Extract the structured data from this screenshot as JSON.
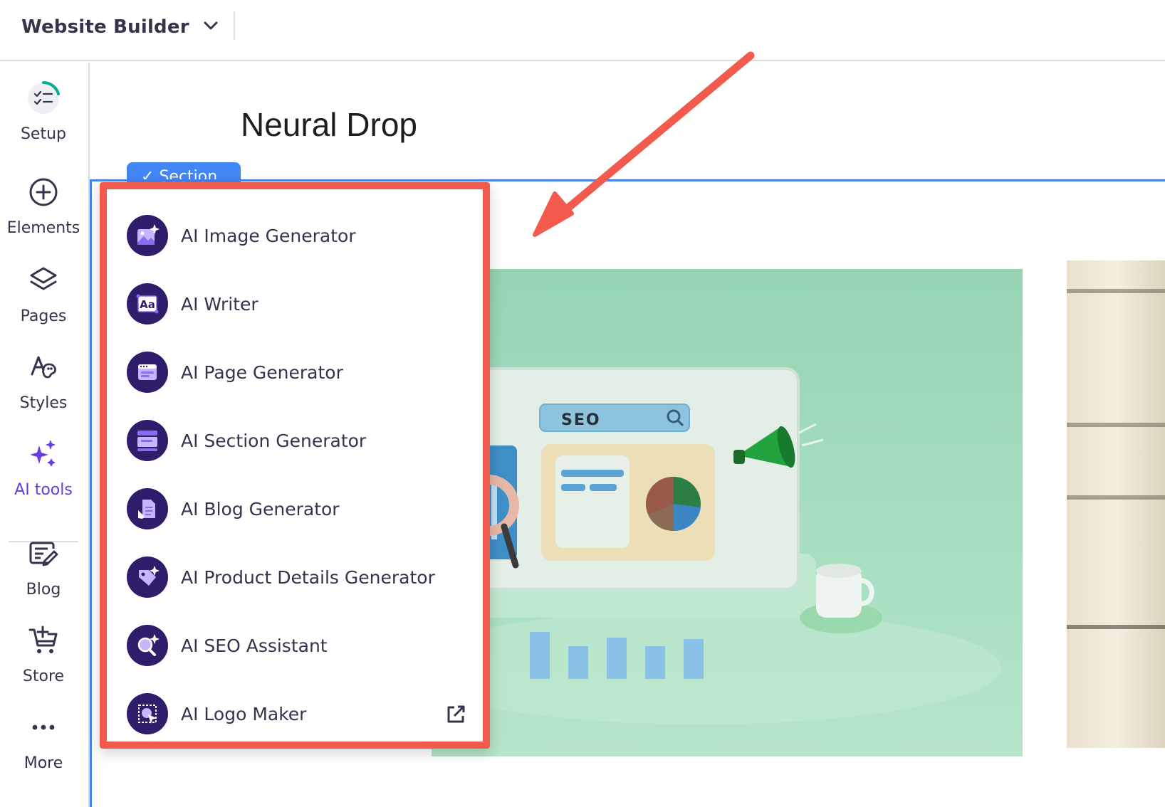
{
  "topbar": {
    "app_title": "Website Builder",
    "app_switch_icon": "chevron-down-icon"
  },
  "sidebar": {
    "items": [
      {
        "label": "Setup",
        "icon": "setup-progress-icon"
      },
      {
        "label": "Elements",
        "icon": "plus-circle-icon"
      },
      {
        "label": "Pages",
        "icon": "layers-icon"
      },
      {
        "label": "Styles",
        "icon": "palette-icon"
      },
      {
        "label": "AI tools",
        "icon": "sparkles-icon",
        "active": true
      },
      {
        "label": "Blog",
        "icon": "blog-edit-icon"
      },
      {
        "label": "Store",
        "icon": "cart-add-icon"
      },
      {
        "label": "More",
        "icon": "more-dots-icon"
      }
    ],
    "active_color": "#673de6"
  },
  "canvas": {
    "site_title": "Neural Drop",
    "section_tag": "Section",
    "hero_search_text": "SEO"
  },
  "ai_menu": {
    "items": [
      {
        "label": "AI Image Generator",
        "icon": "image-sparkle-icon"
      },
      {
        "label": "AI Writer",
        "icon": "text-aa-icon"
      },
      {
        "label": "AI Page Generator",
        "icon": "page-window-icon"
      },
      {
        "label": "AI Section Generator",
        "icon": "section-layout-icon"
      },
      {
        "label": "AI Blog Generator",
        "icon": "blog-document-icon"
      },
      {
        "label": "AI Product Details Generator",
        "icon": "tag-sparkle-icon"
      },
      {
        "label": "AI SEO Assistant",
        "icon": "search-sparkle-icon"
      },
      {
        "label": "AI Logo Maker",
        "icon": "logo-select-icon",
        "external": true
      }
    ],
    "highlight_color": "#f25a4e"
  }
}
